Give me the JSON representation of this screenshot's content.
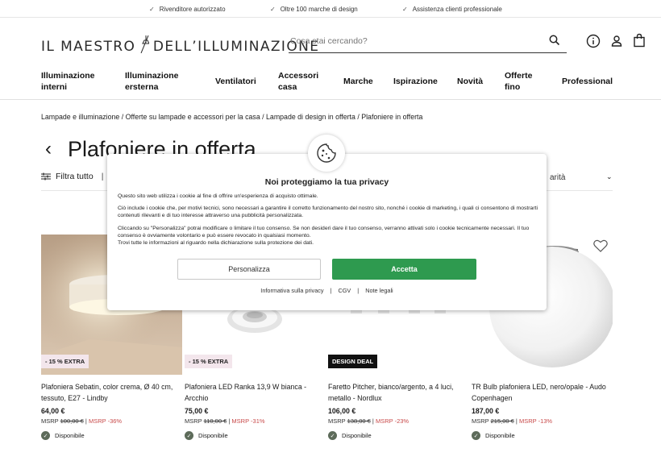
{
  "topbar": {
    "usps": [
      "Rivenditore autorizzato",
      "Oltre 100 marche di design",
      "Assistenza clienti professionale"
    ]
  },
  "header": {
    "logo_left": "IL MAESTRO",
    "logo_right": "DELL’ILLUMINAZIONE",
    "search_placeholder": "Cosa stai cercando?"
  },
  "nav": {
    "items": [
      "Illuminazione interni",
      "Illuminazione ersterna",
      "Ventilatori",
      "Accessori casa",
      "Marche",
      "Ispirazione",
      "Novità",
      "Offerte fino",
      "Professional"
    ],
    "items_split": [
      [
        "Illuminazione",
        "interni"
      ],
      [
        "Illuminazione",
        "ersterna"
      ],
      [
        "Ventilatori"
      ],
      [
        "Accessori",
        "casa"
      ],
      [
        "Marche"
      ],
      [
        "Ispirazione"
      ],
      [
        "Novità"
      ],
      [
        "Offerte",
        "fino"
      ],
      [
        "Professional"
      ]
    ]
  },
  "breadcrumb": "Lampade e illuminazione / Offerte su lampade e accessori per la casa / Lampade di design in offerta / Plafoniere in offerta",
  "page_title": "Plafoniere in offerta",
  "toolbar": {
    "filter_label": "Filtra tutto",
    "sort_label": "arità"
  },
  "products": [
    {
      "badge": "- 15 % EXTRA",
      "badge_style": "extra",
      "name": "Plafoniera Sebatin, color crema, Ø 40 cm, tessuto, E27 - Lindby",
      "price": "64,00 €",
      "msrp_label": "MSRP",
      "msrp_old": "100,00 €",
      "msrp_pct": "MSRP -36%",
      "availability": "Disponibile"
    },
    {
      "badge": "- 15 % EXTRA",
      "badge_style": "extra",
      "name": "Plafoniera LED Ranka 13,9 W bianca - Arcchio",
      "price": "75,00 €",
      "msrp_label": "MSRP",
      "msrp_old": "110,00 €",
      "msrp_pct": "MSRP -31%",
      "availability": "Disponibile"
    },
    {
      "badge": "DESIGN DEAL",
      "badge_style": "deal",
      "name": "Faretto Pitcher, bianco/argento, a 4 luci, metallo - Nordlux",
      "price": "106,00 €",
      "msrp_label": "MSRP",
      "msrp_old": "138,00 €",
      "msrp_pct": "MSRP -23%",
      "availability": "Disponibile"
    },
    {
      "badge": "",
      "badge_style": "none",
      "name": "TR Bulb plafoniera LED, nero/opale - Audo Copenhagen",
      "price": "187,00 €",
      "msrp_label": "MSRP",
      "msrp_old": "215,00 €",
      "msrp_pct": "MSRP -13%",
      "availability": "Disponibile"
    }
  ],
  "cookie_modal": {
    "title": "Noi proteggiamo la tua privacy",
    "p1": "Questo sito web utilizza i cookie al fine di offrire un'esperienza di acquisto ottimale.",
    "p2": "Ciò include i cookie che, per motivi tecnici, sono necessari a garantire il corretto funzionamento del nostro sito, nonché i cookie di marketing, i quali ci consentono di mostrarti contenuti rilevanti e di tuo interesse attraverso una pubblicità personalizzata.",
    "p3": "Cliccando su \"Personalizza\" potrai modificare o limitare il tuo consenso. Se non desideri dare il tuo consenso, verranno attivati solo i cookie tecnicamente necessari. Il tuo consenso è ovviamente volontario e può essere revocato in qualsiasi momento.",
    "p4": "Trovi tutte le informazioni al riguardo nella dichiarazione sulla protezione dei dati.",
    "btn_personalizza": "Personalizza",
    "btn_accetta": "Accetta",
    "links": [
      "Informativa sulla privacy",
      "CGV",
      "Note legali"
    ]
  },
  "colors": {
    "accept_green": "#2e9a4f",
    "extra_badge_bg": "#f3e6ec",
    "deal_badge_bg": "#111111",
    "msrp_discount": "#c84a4a",
    "availability_dot": "#5d6b5a"
  }
}
